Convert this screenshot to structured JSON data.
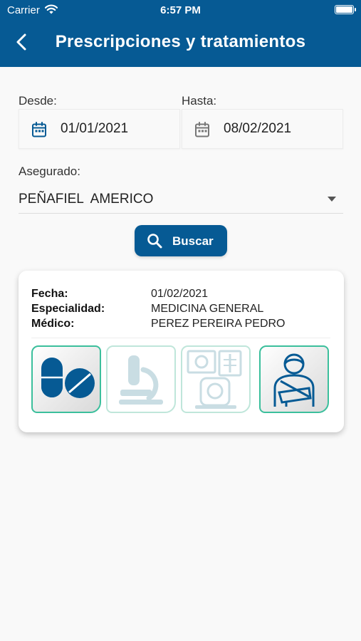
{
  "status_bar": {
    "carrier": "Carrier",
    "time": "6:57 PM"
  },
  "header": {
    "title": "Prescripciones y tratamientos"
  },
  "filters": {
    "from_label": "Desde:",
    "from_value": "01/01/2021",
    "to_label": "Hasta:",
    "to_value": "08/02/2021",
    "insured_label": "Asegurado:",
    "insured_value": "PEÑAFIEL  AMERICO",
    "search_label": "Buscar"
  },
  "result": {
    "date_label": "Fecha:",
    "date_value": "01/02/2021",
    "specialty_label": "Especialidad:",
    "specialty_value": "MEDICINA GENERAL",
    "doctor_label": "Médico:",
    "doctor_value": "PEREZ PEREIRA PEDRO",
    "categories": [
      {
        "icon": "pills-icon",
        "active": true
      },
      {
        "icon": "microscope-icon",
        "active": false
      },
      {
        "icon": "imaging-scanner-icon",
        "active": false
      },
      {
        "icon": "arm-sling-icon",
        "active": true
      }
    ]
  },
  "colors": {
    "primary": "#065a94",
    "tile_border": "#3bbf9c",
    "icon_active": "#065a94",
    "icon_inactive": "#c9dde3"
  }
}
